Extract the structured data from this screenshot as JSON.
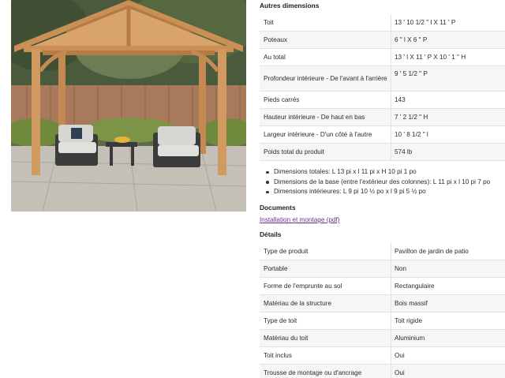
{
  "image": {
    "alt_icon": "gazebo-photo"
  },
  "dimensions": {
    "title": "Autres dimensions",
    "rows": [
      {
        "label": "Toit",
        "value": "13 ' 10 1/2 \" l X 11 ' P"
      },
      {
        "label": "Poteaux",
        "value": "6 \" l X 6 \" P"
      },
      {
        "label": "Au total",
        "value": "13 ' l X 11 ' P X 10 ' 1 \" H"
      },
      {
        "label": "Profondeur intérieure - De l'avant à l'arrière",
        "value": "9 ' 5 1/2 \" P"
      },
      {
        "label": "Pieds carrés",
        "value": "143"
      },
      {
        "label": "Hauteur intérieure - De haut en bas",
        "value": "7 ' 2 1/2 \" H"
      },
      {
        "label": "Largeur intérieure - D'un côté à l'autre",
        "value": "10 ' 8 1/2 \" l"
      },
      {
        "label": "Poids total du produit",
        "value": "574 lb"
      }
    ],
    "bullets": [
      "Dimensions totales: L 13 pi x l 11 pi x H 10 pi 1 po",
      "Dimensions de la base (entre l'extérieur des colonnes): L 11 pi x l 10 pi 7 po",
      "Dimensions intérieures: L 9 pi 10 ½ po x l 9 pi 5 ½ po"
    ]
  },
  "documents": {
    "title": "Documents",
    "link": "Installation et montage (pdf)"
  },
  "details": {
    "title": "Détails",
    "rows": [
      {
        "label": "Type de produit",
        "value": "Pavillon de jardin de patio"
      },
      {
        "label": "Portable",
        "value": "Non"
      },
      {
        "label": "Forme de l'emprunte au sol",
        "value": "Rectangulaire"
      },
      {
        "label": "Matériau de la structure",
        "value": "Bois massif"
      },
      {
        "label": "Type de toit",
        "value": "Toit rigide"
      },
      {
        "label": "Matériau du toit",
        "value": "Aluminium"
      },
      {
        "label": "Toit inclus",
        "value": "Oui"
      },
      {
        "label": "Trousse de montage ou d'ancrage",
        "value": "Oui"
      }
    ]
  },
  "colors": {
    "link": "#6b2f8f",
    "row_shade": "#f6f6f6",
    "border": "#e2e2e2"
  }
}
